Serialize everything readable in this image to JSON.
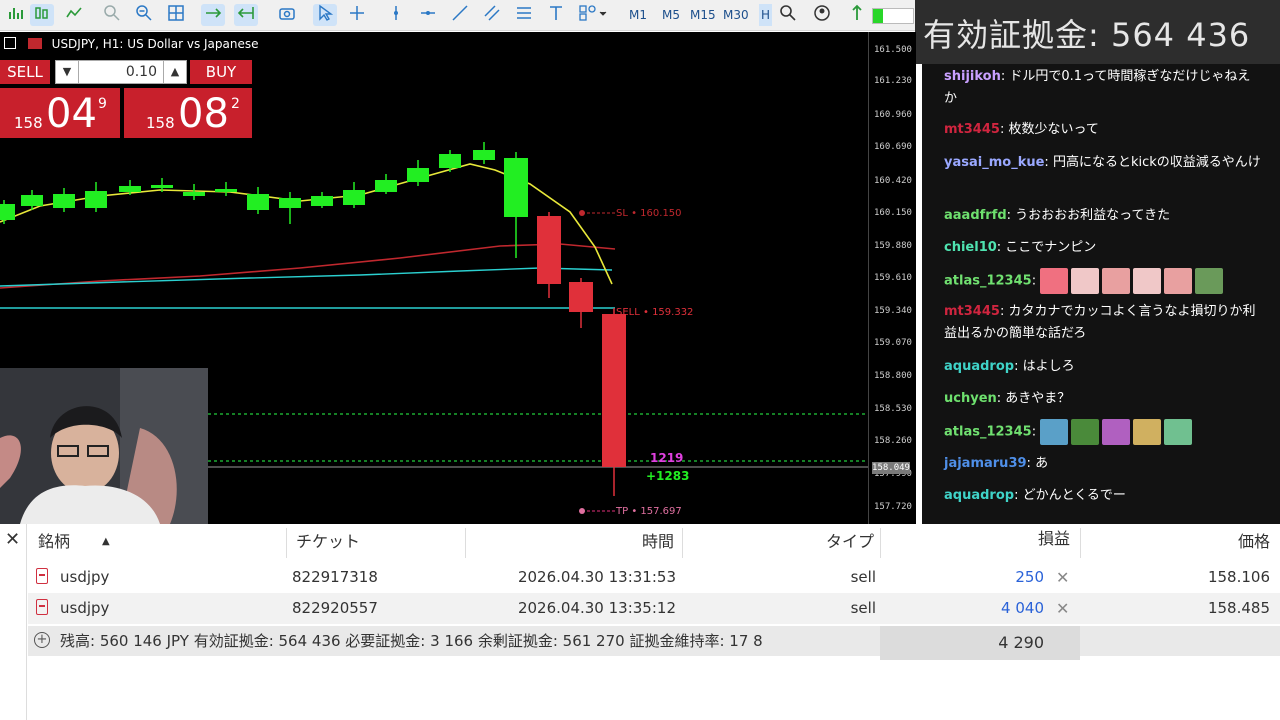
{
  "toolbar": {
    "timeframes": [
      "M1",
      "M5",
      "M15",
      "M30",
      "H"
    ]
  },
  "overlay": {
    "equity_text": "有効証拠金: 564 436"
  },
  "chart": {
    "title": "USDJPY, H1:  US Dollar vs Japanese",
    "price_ticks": [
      "161.500",
      "161.230",
      "160.960",
      "160.690",
      "160.420",
      "160.150",
      "159.880",
      "159.610",
      "159.340",
      "159.070",
      "158.800",
      "158.530",
      "158.260",
      "157.990",
      "157.720"
    ],
    "current_price_label": "158.049",
    "sl_label": "SL • 160.150",
    "sell_label": "SELL • 159.332",
    "tp_label": "TP • 157.697",
    "profit_label_1": "1219",
    "profit_label_2": "+1283",
    "colors": {
      "bull": "#22ee22",
      "bear": "#e0303a",
      "ma_fast": "#e8e83a",
      "ma_mid": "#c0282e",
      "ma_slow": "#2bd0d0"
    }
  },
  "trade_panel": {
    "sell_label": "SELL",
    "buy_label": "BUY",
    "volume": "0.10",
    "sell_price_prefix": "158",
    "sell_price_big": "04",
    "sell_price_sup": "9",
    "buy_price_prefix": "158",
    "buy_price_big": "08",
    "buy_price_sup": "2"
  },
  "chat": {
    "messages": [
      {
        "user": "shijikoh",
        "color": "#c9a0ff",
        "text": "ドル円で0.1って時間稼ぎなだけじゃねえか"
      },
      {
        "user": "mt3445",
        "color": "#d0253f",
        "text": "枚数少ないって"
      },
      {
        "user": "yasai_mo_kue",
        "color": "#9aa8ff",
        "text": "円高になるとkickの収益減るやんけ"
      },
      {
        "user": "aaadfrfd",
        "color": "#6ee06e",
        "text": "うおおおお利益なってきた"
      },
      {
        "user": "chiel10",
        "color": "#4fe3b0",
        "text": "ここでナンピン"
      },
      {
        "user": "atlas_12345",
        "color": "#70e070",
        "text": ""
      },
      {
        "user": "mt3445",
        "color": "#d0253f",
        "text": "カタカナでカッコよく言うなよ損切りか利益出るかの簡単な話だろ"
      },
      {
        "user": "aquadrop",
        "color": "#3fd3c8",
        "text": "はよしろ"
      },
      {
        "user": "uchyen",
        "color": "#6ee06e",
        "text": "あきやま？"
      },
      {
        "user": "atlas_12345",
        "color": "#70e070",
        "text": ""
      },
      {
        "user": "jajamaru39",
        "color": "#4f8fe8",
        "text": "あ"
      },
      {
        "user": "aquadrop",
        "color": "#3fd3c8",
        "text": "どかんとくるでー"
      }
    ]
  },
  "positions": {
    "headers": {
      "symbol": "銘柄",
      "ticket": "チケット",
      "time": "時間",
      "type": "タイプ",
      "profit": "損益",
      "price": "価格"
    },
    "rows": [
      {
        "symbol": "usdjpy",
        "ticket": "822917318",
        "time": "2026.04.30 13:31:53",
        "type": "sell",
        "profit": "250",
        "price": "158.106"
      },
      {
        "symbol": "usdjpy",
        "ticket": "822920557",
        "time": "2026.04.30 13:35:12",
        "type": "sell",
        "profit": "4 040",
        "price": "158.485"
      }
    ],
    "summary": "残高: 560 146 JPY  有効証拠金: 564 436  必要証拠金: 3 166  余剰証拠金: 561 270  証拠金維持率: 17 8",
    "total_profit": "4 290"
  }
}
